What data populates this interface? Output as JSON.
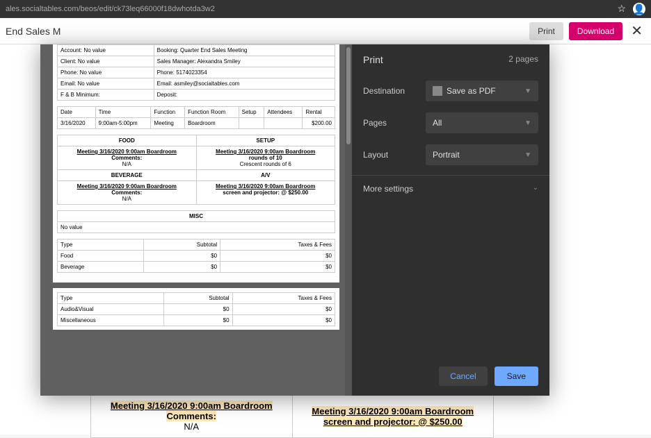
{
  "browser": {
    "url": "ales.socialtables.com/beos/edit/ck73leq66000f18dwhotda3w2"
  },
  "header": {
    "title": "End Sales M",
    "print": "Print",
    "download": "Download",
    "close": "✕"
  },
  "print_panel": {
    "title": "Print",
    "page_count": "2 pages",
    "dest_label": "Destination",
    "dest_value": "Save as PDF",
    "pages_label": "Pages",
    "pages_value": "All",
    "layout_label": "Layout",
    "layout_value": "Portrait",
    "more": "More settings",
    "cancel": "Cancel",
    "save": "Save"
  },
  "info": {
    "account": "Account: No value",
    "booking": "Booking: Quarter End Sales Meeting",
    "client": "Client: No value",
    "manager": "Sales Manager: Alexandra Smiley",
    "phone": "Phone: No value",
    "phone2": "Phone: 5174023354",
    "email": "Email: No value",
    "email2": "Email: asmiley@socialtables.com",
    "fb": "F & B Minimum:",
    "deposit": "Deposit:"
  },
  "sched": {
    "h_date": "Date",
    "h_time": "Time",
    "h_func": "Function",
    "h_room": "Function Room",
    "h_setup": "Setup",
    "h_att": "Attendees",
    "h_rental": "Rental",
    "date": "3/16/2020",
    "time": "9:00am-5:00pm",
    "func": "Meeting",
    "room": "Boardroom",
    "setup": "",
    "att": "",
    "rental": "$200.00"
  },
  "details": {
    "food": "FOOD",
    "setup": "SETUP",
    "bev": "BEVERAGE",
    "av": "A/V",
    "misc": "MISC",
    "link": "Meeting 3/16/2020 9:00am Boardroom",
    "comments": "Comments:",
    "na": "N/A",
    "rounds10": "rounds of 10",
    "crescent": "Crescent rounds of 6",
    "screen": "screen and projector: @ $250.00",
    "novalue": "No value"
  },
  "totals": {
    "h_type": "Type",
    "h_sub": "Subtotal",
    "h_tax": "Taxes & Fees",
    "r1": "Food",
    "r2": "Beverage",
    "r3": "Audio&Visual",
    "r4": "Miscellaneous",
    "zero": "$0"
  },
  "under": {
    "na": "N/A",
    "crescent": "Crescent rounds of 6",
    "bev": "BEVERAGE",
    "av": "A/V",
    "link": "Meeting 3/16/2020 9:00am Boardroom",
    "comments": "Comments:",
    "screen": "screen and projector: @ $250.00"
  }
}
